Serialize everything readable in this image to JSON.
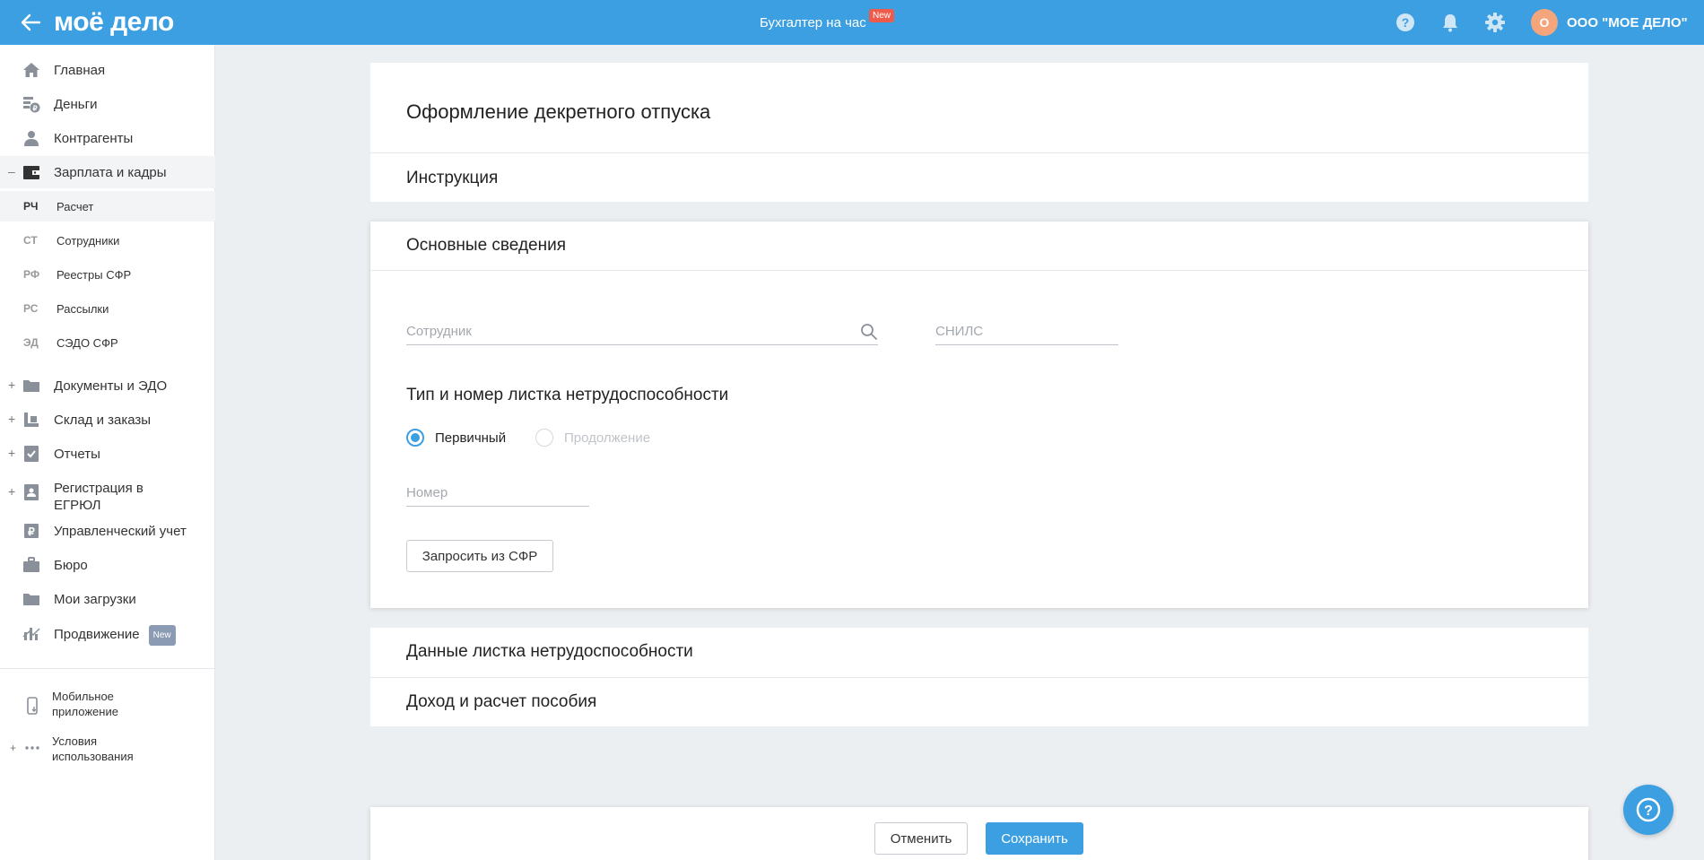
{
  "header": {
    "logo": "моё дело",
    "center_link": "Бухгалтер на час",
    "center_badge": "New",
    "avatar_letter": "О",
    "org_name": "ООО \"МОЕ ДЕЛО\"",
    "brand_color": "#3b9fe1",
    "icons": [
      "arrow-left-icon",
      "help-icon",
      "bell-icon",
      "gear-icon"
    ]
  },
  "sidebar": {
    "items": [
      {
        "label": "Главная",
        "icon": "home-icon"
      },
      {
        "label": "Деньги",
        "icon": "money-icon"
      },
      {
        "label": "Контрагенты",
        "icon": "contractors-icon"
      },
      {
        "label": "Зарплата и кадры",
        "icon": "wallet-icon",
        "expander": "–"
      }
    ],
    "subitems": [
      {
        "abbr": "РЧ",
        "label": "Расчет"
      },
      {
        "abbr": "СТ",
        "label": "Сотрудники"
      },
      {
        "abbr": "РФ",
        "label": "Реестры СФР"
      },
      {
        "abbr": "РС",
        "label": "Рассылки"
      },
      {
        "abbr": "ЭД",
        "label": "СЭДО СФР"
      }
    ],
    "items2": [
      {
        "label": "Документы и ЭДО",
        "icon": "folder-icon",
        "expander": "+"
      },
      {
        "label": "Склад и заказы",
        "icon": "warehouse-icon",
        "expander": "+"
      },
      {
        "label": "Отчеты",
        "icon": "reports-icon",
        "expander": "+"
      },
      {
        "label": "Регистрация в ЕГРЮЛ",
        "icon": "registration-icon",
        "expander": "+"
      },
      {
        "label": "Управленческий учет",
        "icon": "management-icon"
      },
      {
        "label": "Бюро",
        "icon": "briefcase-icon"
      },
      {
        "label": "Мои загрузки",
        "icon": "downloads-folder-icon"
      },
      {
        "label": "Продвижение",
        "icon": "chart-icon",
        "badge": "New"
      }
    ],
    "footer": [
      {
        "label": "Мобильное приложение",
        "icon": "mobile-icon"
      },
      {
        "label": "Условия использования",
        "icon": "more-dots-icon",
        "expander": "+"
      }
    ]
  },
  "main": {
    "page_title": "Оформление декретного отпуска",
    "instruction_title": "Инструкция",
    "basic_info_title": "Основные сведения",
    "employee_placeholder": "Сотрудник",
    "employee_value": "",
    "snils_placeholder": "СНИЛС",
    "snils_value": "",
    "sick_leave_type_title": "Тип и номер листка нетрудоспособности",
    "radio_primary": "Первичный",
    "radio_continuation": "Продолжение",
    "radio_selected": "Первичный",
    "number_placeholder": "Номер",
    "number_value": "",
    "request_button": "Запросить из СФР",
    "sick_leave_data_title": "Данные листка нетрудоспособности",
    "income_title": "Доход и расчет пособия",
    "cancel_button": "Отменить",
    "save_button": "Сохранить"
  }
}
